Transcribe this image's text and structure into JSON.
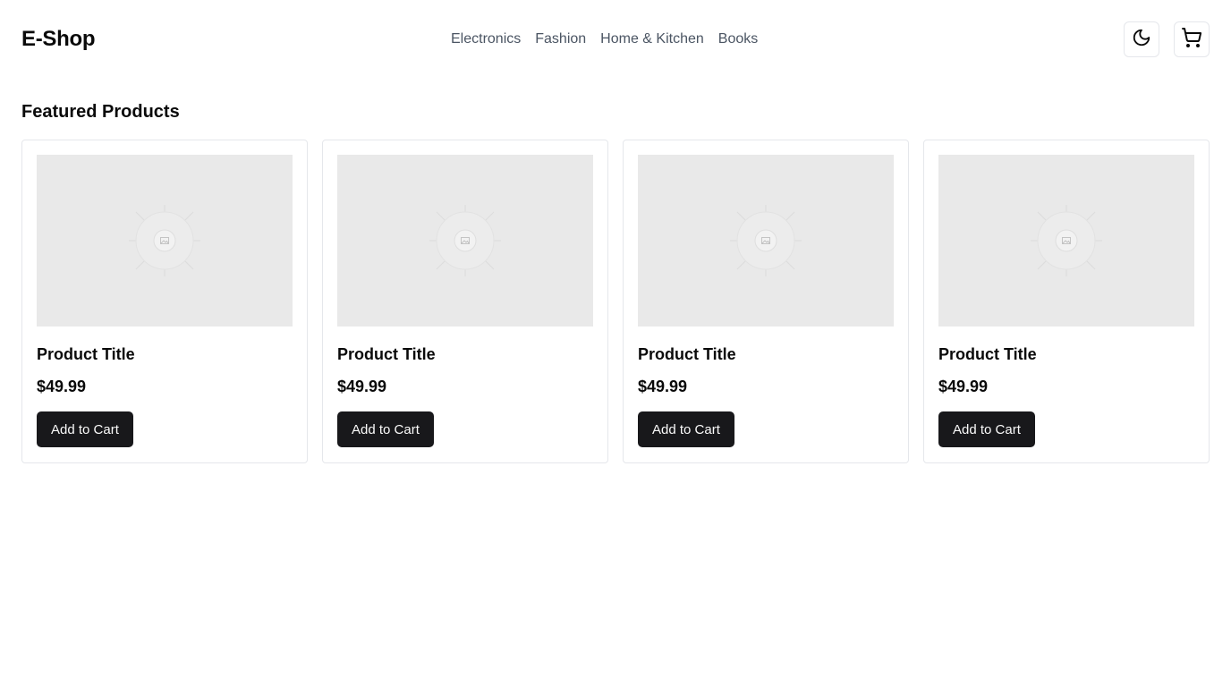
{
  "header": {
    "logo": "E-Shop",
    "nav": [
      "Electronics",
      "Fashion",
      "Home & Kitchen",
      "Books"
    ],
    "icons": [
      "moon-icon",
      "shopping-cart-icon"
    ]
  },
  "main": {
    "section_title": "Featured Products",
    "products": [
      {
        "title": "Product Title",
        "price": "$49.99",
        "button": "Add to Cart"
      },
      {
        "title": "Product Title",
        "price": "$49.99",
        "button": "Add to Cart"
      },
      {
        "title": "Product Title",
        "price": "$49.99",
        "button": "Add to Cart"
      },
      {
        "title": "Product Title",
        "price": "$49.99",
        "button": "Add to Cart"
      }
    ]
  },
  "colors": {
    "button_bg": "#18181b",
    "nav_text": "#4b5563",
    "placeholder_bg": "#e9e9e9",
    "card_border": "#e5e7eb"
  }
}
